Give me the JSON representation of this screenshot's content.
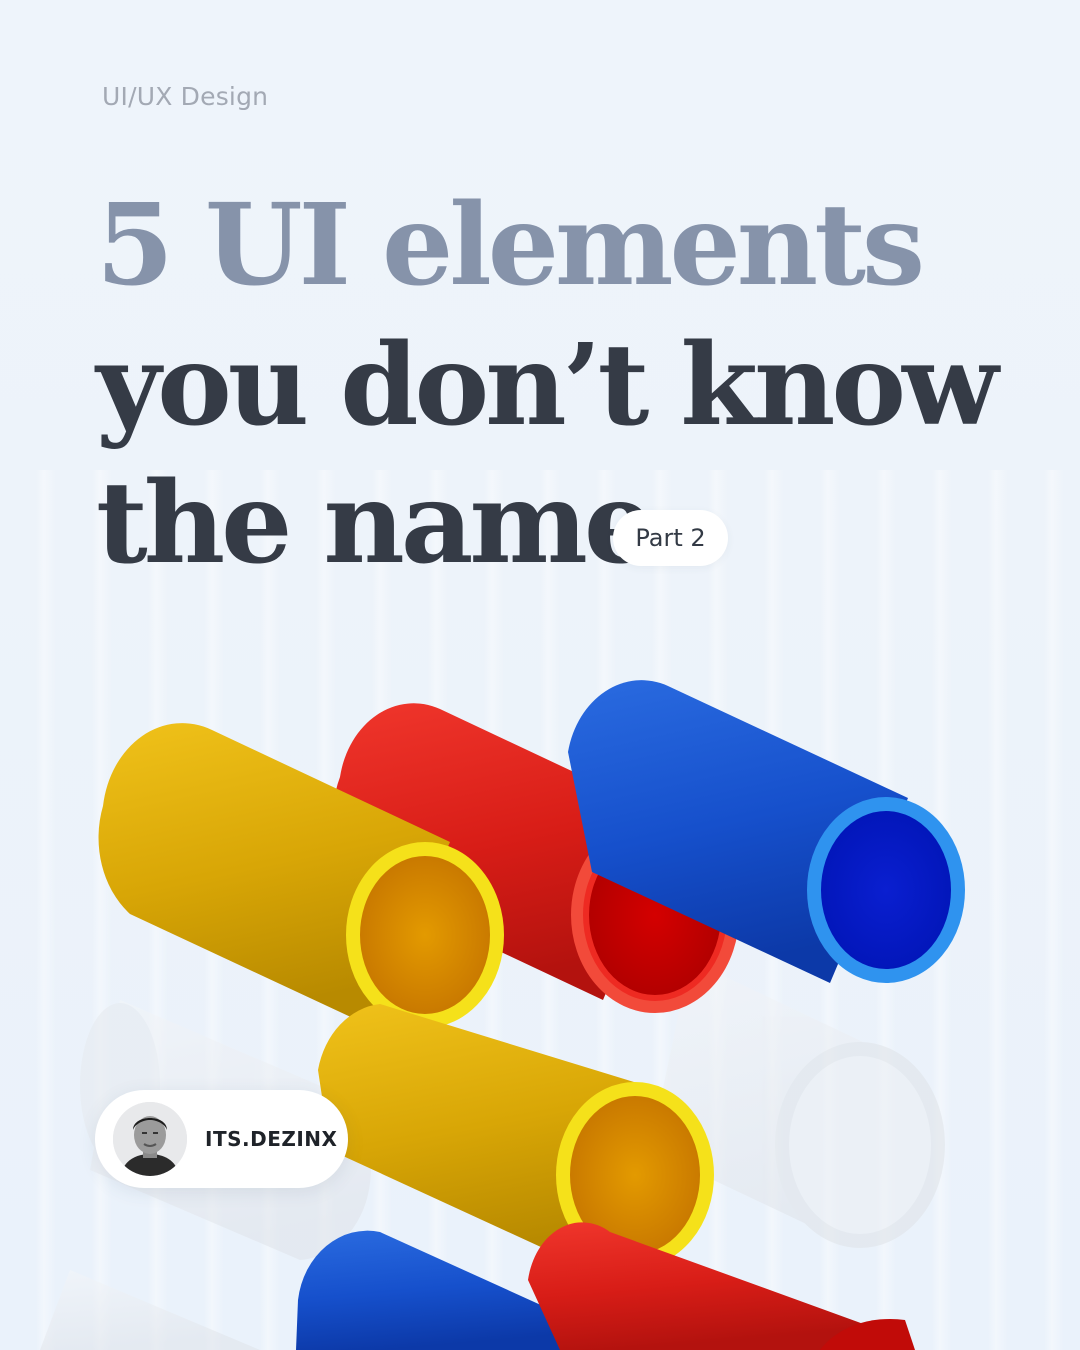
{
  "category": "UI/UX Design",
  "headline": {
    "line1": "5 UI elements",
    "line2": "you don’t know",
    "line3": "the name"
  },
  "badge": "Part 2",
  "author": {
    "handle": "ITS.DEZINX",
    "avatar": "author-photo"
  },
  "colors": {
    "background": "#eef4fb",
    "headline_muted": "#8693aa",
    "headline_dark": "#353b46",
    "tube_yellow": "#e6b800",
    "tube_red": "#e0201c",
    "tube_blue": "#1559d6"
  }
}
